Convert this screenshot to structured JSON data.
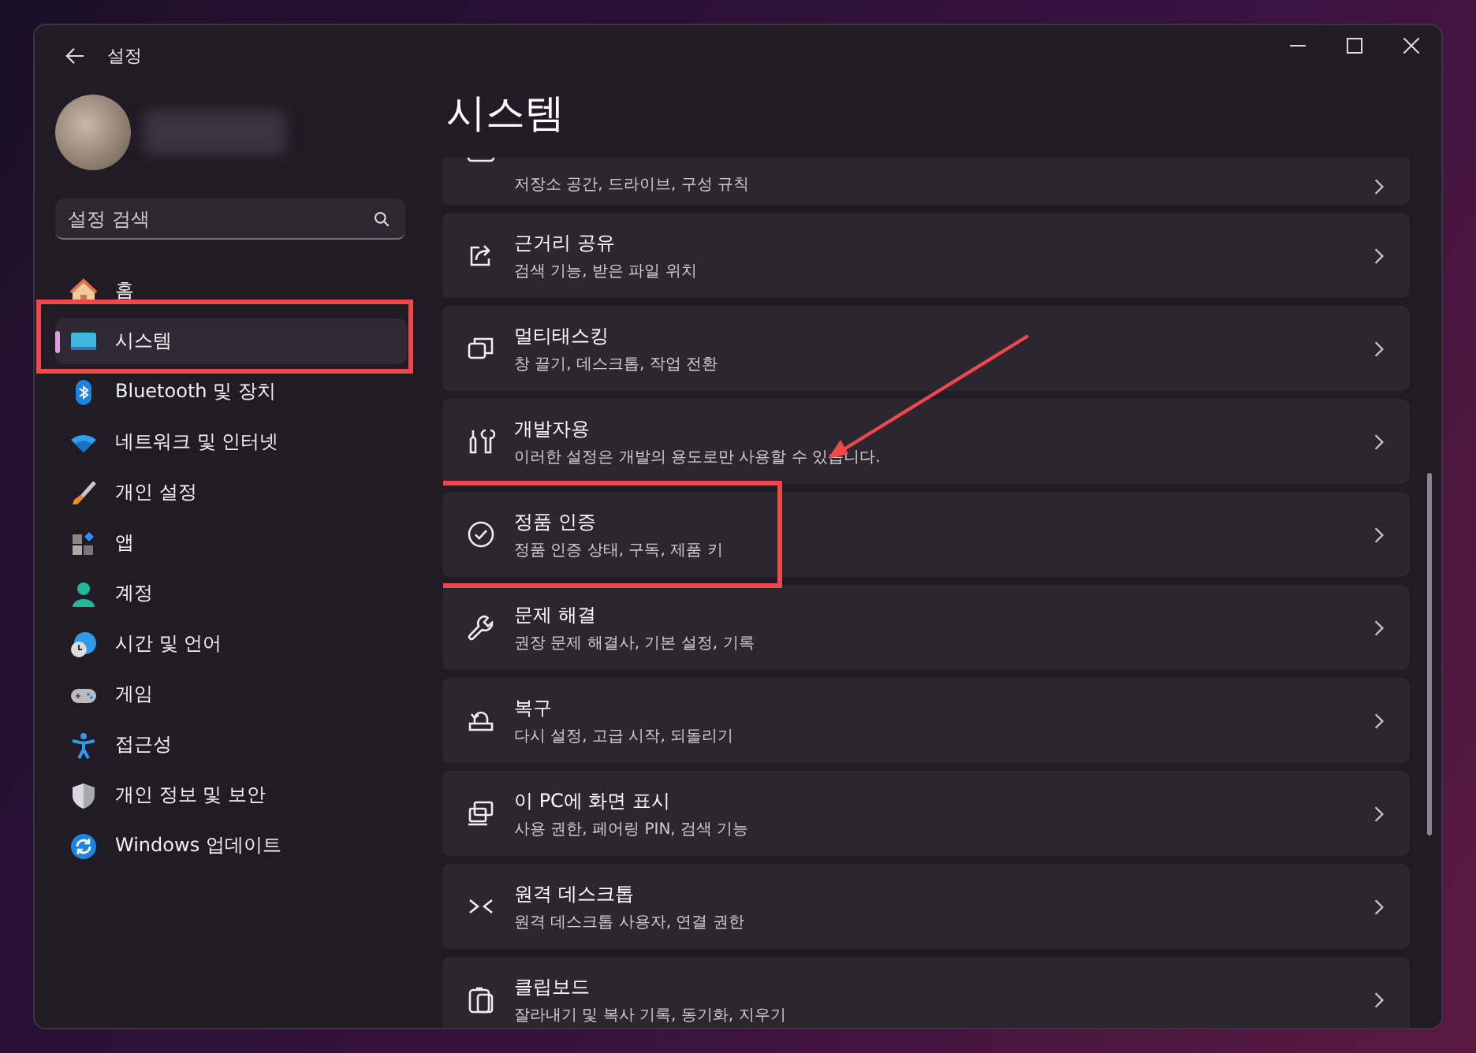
{
  "window": {
    "title": "설정"
  },
  "search": {
    "placeholder": "설정 검색"
  },
  "sidebar": {
    "items": [
      {
        "label": "홈",
        "selected": false,
        "highlighted": false
      },
      {
        "label": "시스템",
        "selected": true,
        "highlighted": true
      },
      {
        "label": "Bluetooth 및 장치",
        "selected": false,
        "highlighted": false
      },
      {
        "label": "네트워크 및 인터넷",
        "selected": false,
        "highlighted": false
      },
      {
        "label": "개인 설정",
        "selected": false,
        "highlighted": false
      },
      {
        "label": "앱",
        "selected": false,
        "highlighted": false
      },
      {
        "label": "계정",
        "selected": false,
        "highlighted": false
      },
      {
        "label": "시간 및 언어",
        "selected": false,
        "highlighted": false
      },
      {
        "label": "게임",
        "selected": false,
        "highlighted": false
      },
      {
        "label": "접근성",
        "selected": false,
        "highlighted": false
      },
      {
        "label": "개인 정보 및 보안",
        "selected": false,
        "highlighted": false
      },
      {
        "label": "Windows 업데이트",
        "selected": false,
        "highlighted": false
      }
    ]
  },
  "page_title": "시스템",
  "cards": [
    {
      "description": "저장소 공간, 드라이브, 구성 규칙",
      "highlighted": false,
      "arrow_pointed": false
    },
    {
      "title": "근거리 공유",
      "description": "검색 기능, 받은 파일 위치",
      "highlighted": false,
      "arrow_pointed": false
    },
    {
      "title": "멀티태스킹",
      "description": "창 끌기, 데스크톱, 작업 전환",
      "highlighted": false,
      "arrow_pointed": false
    },
    {
      "title": "개발자용",
      "description": "이러한 설정은 개발의 용도로만 사용할 수 있습니다.",
      "highlighted": false,
      "arrow_pointed": true
    },
    {
      "title": "정품 인증",
      "description": "정품 인증 상태, 구독, 제품 키",
      "highlighted": true,
      "arrow_pointed": false
    },
    {
      "title": "문제 해결",
      "description": "권장 문제 해결사, 기본 설정, 기록",
      "highlighted": false,
      "arrow_pointed": false
    },
    {
      "title": "복구",
      "description": "다시 설정, 고급 시작, 되돌리기",
      "highlighted": false,
      "arrow_pointed": false
    },
    {
      "title": "이 PC에 화면 표시",
      "description": "사용 권한, 페어링 PIN, 검색 기능",
      "highlighted": false,
      "arrow_pointed": false
    },
    {
      "title": "원격 데스크톱",
      "description": "원격 데스크톱 사용자, 연결 권한",
      "highlighted": false,
      "arrow_pointed": false
    },
    {
      "title": "클립보드",
      "description": "잘라내기 및 복사 기록, 동기화, 지우기",
      "highlighted": false,
      "arrow_pointed": false
    }
  ]
}
